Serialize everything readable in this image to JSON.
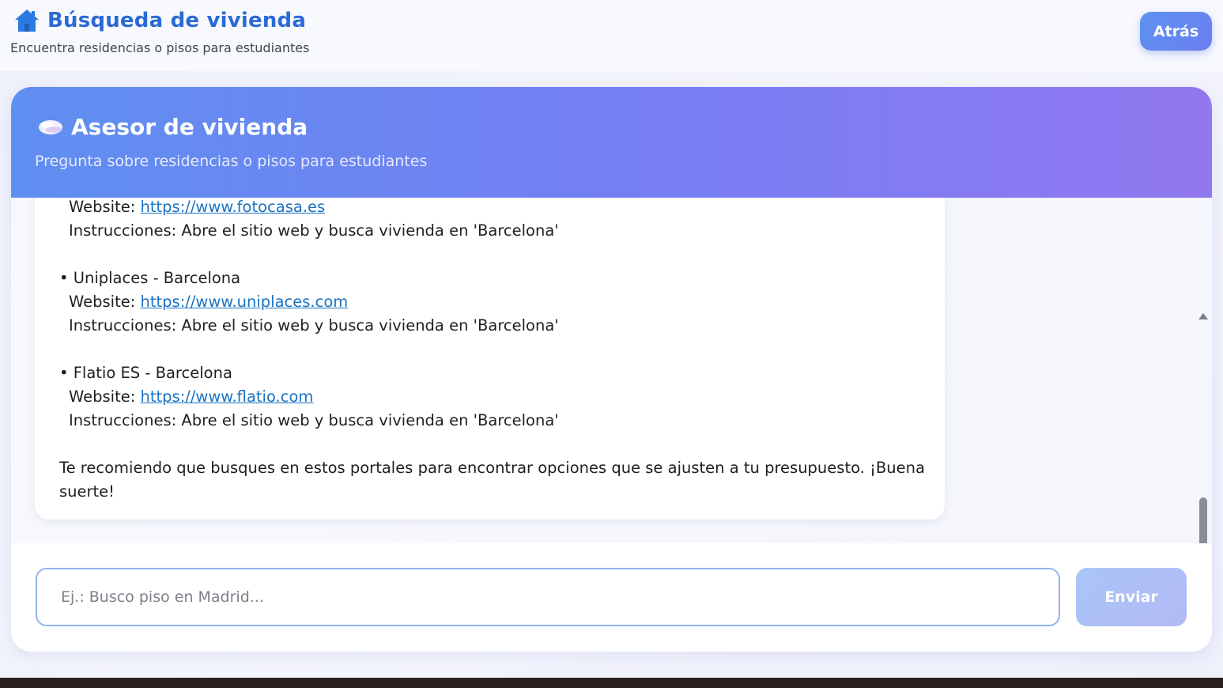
{
  "header": {
    "title": "Búsqueda de vivienda",
    "subtitle": "Encuentra residencias o pisos para estudiantes",
    "back_label": "Atrás",
    "icon": "house-icon"
  },
  "advisor": {
    "title": "Asesor de vivienda",
    "subtitle": "Pregunta sobre residencias o pisos para estudiantes",
    "icon": "speech-bubble-icon"
  },
  "message": {
    "lines": [
      {
        "prefix": "Website: ",
        "link": "https://www.fotocasa.es"
      },
      {
        "text": "Instrucciones: Abre el sitio web y busca vivienda en 'Barcelona'"
      },
      {
        "text": "• Uniplaces - Barcelona"
      },
      {
        "prefix": "Website: ",
        "link": "https://www.uniplaces.com"
      },
      {
        "text": "Instrucciones: Abre el sitio web y busca vivienda en 'Barcelona'"
      },
      {
        "text": "• Flatio ES - Barcelona"
      },
      {
        "prefix": "Website: ",
        "link": "https://www.flatio.com"
      },
      {
        "text": "Instrucciones: Abre el sitio web y busca vivienda en 'Barcelona'"
      },
      {
        "text": "Te recomiendo que busques en estos portales para encontrar opciones que se ajusten a tu presupuesto. ¡Buena"
      },
      {
        "text": "suerte!"
      }
    ]
  },
  "composer": {
    "placeholder": "Ej.: Busco piso en Madrid...",
    "value": "",
    "send_label": "Enviar"
  },
  "colors": {
    "accent": "#2a6ad6",
    "header_gradient_start": "#5f8ff0",
    "header_gradient_end": "#9177f0",
    "link": "#1a73c2"
  }
}
